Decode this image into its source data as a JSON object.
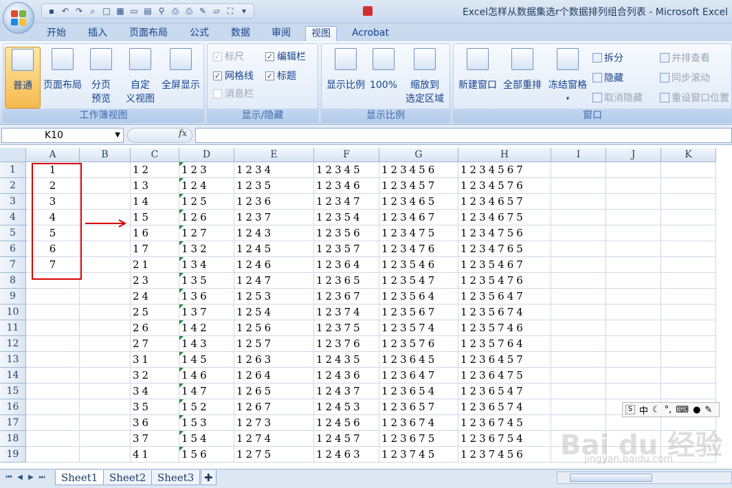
{
  "window": {
    "title": "Excel怎样从数据集选r个数据排列组合列表 - Microsoft Excel"
  },
  "ribbon_tabs": [
    "开始",
    "插入",
    "页面布局",
    "公式",
    "数据",
    "审阅",
    "视图",
    "Acrobat"
  ],
  "active_tab": "视图",
  "ribbon": {
    "workbook_views": {
      "label": "工作簿视图",
      "normal": "普通",
      "page_layout": "页面布局",
      "page_break": [
        "分页",
        "预览"
      ],
      "custom": [
        "自定",
        "义视图"
      ],
      "fullscreen": "全屏显示"
    },
    "show_hide": {
      "label": "显示/隐藏",
      "ruler": "标尺",
      "formula_bar": "编辑栏",
      "gridlines": "网格线",
      "headings": "标题",
      "message_bar": "消息栏"
    },
    "zoom": {
      "label": "显示比例",
      "zoom": "显示比例",
      "hundred": "100%",
      "zoom_selection": [
        "缩放到",
        "选定区域"
      ]
    },
    "window": {
      "label": "窗口",
      "new_window": "新建窗口",
      "arrange_all": "全部重排",
      "freeze": "冻结窗格",
      "split": "拆分",
      "hide": "隐藏",
      "unhide": "取消隐藏",
      "side_by_side": "并排查看",
      "sync_scroll": "同步滚动",
      "reset_pos": "重设窗口位置"
    }
  },
  "formula_bar": {
    "name_box": "K10",
    "fx": "fx",
    "value": ""
  },
  "columns": [
    "A",
    "B",
    "C",
    "D",
    "E",
    "F",
    "G",
    "H",
    "I",
    "J",
    "K"
  ],
  "rows": [
    "1",
    "2",
    "3",
    "4",
    "5",
    "6",
    "7",
    "8",
    "9",
    "10",
    "11",
    "12",
    "13",
    "14",
    "15",
    "16",
    "17",
    "18",
    "19"
  ],
  "cells": {
    "A": [
      "1",
      "2",
      "3",
      "4",
      "5",
      "6",
      "7",
      "",
      "",
      "",
      "",
      "",
      "",
      "",
      "",
      "",
      "",
      "",
      ""
    ],
    "C": [
      "12",
      "13",
      "14",
      "15",
      "16",
      "17",
      "21",
      "23",
      "24",
      "25",
      "26",
      "27",
      "31",
      "32",
      "34",
      "35",
      "36",
      "37",
      "41"
    ],
    "D": [
      "123",
      "124",
      "125",
      "126",
      "127",
      "132",
      "134",
      "135",
      "136",
      "137",
      "142",
      "143",
      "145",
      "146",
      "147",
      "152",
      "153",
      "154",
      "156"
    ],
    "E": [
      "1234",
      "1235",
      "1236",
      "1237",
      "1243",
      "1245",
      "1246",
      "1247",
      "1253",
      "1254",
      "1256",
      "1257",
      "1263",
      "1264",
      "1265",
      "1267",
      "1273",
      "1274",
      "1275"
    ],
    "F": [
      "12345",
      "12346",
      "12347",
      "12354",
      "12356",
      "12357",
      "12364",
      "12365",
      "12367",
      "12374",
      "12375",
      "12376",
      "12435",
      "12436",
      "12437",
      "12453",
      "12456",
      "12457",
      "12463"
    ],
    "G": [
      "123456",
      "123457",
      "123465",
      "123467",
      "123475",
      "123476",
      "123546",
      "123547",
      "123564",
      "123567",
      "123574",
      "123576",
      "123645",
      "123647",
      "123654",
      "123657",
      "123674",
      "123675",
      "123745"
    ],
    "H": [
      "1234567",
      "1234576",
      "1234657",
      "1234675",
      "1234756",
      "1234765",
      "1235467",
      "1235476",
      "1235647",
      "1235674",
      "1235746",
      "1235764",
      "1236457",
      "1236475",
      "1236547",
      "1236574",
      "1236745",
      "1236754",
      "1237456"
    ]
  },
  "sheet_tabs": [
    "Sheet1",
    "Sheet2",
    "Sheet3"
  ],
  "active_sheet": "Sheet1",
  "ime_bar": {
    "mode": "中"
  },
  "watermark": {
    "main": "Bai du 经验",
    "sub": "jingyan.baidu.com"
  },
  "colors": {
    "annotation_red": "#d40000",
    "ribbon_text": "#15428b",
    "selected_btn": "#f7b94e",
    "text_marker_green": "#1f8a35"
  }
}
